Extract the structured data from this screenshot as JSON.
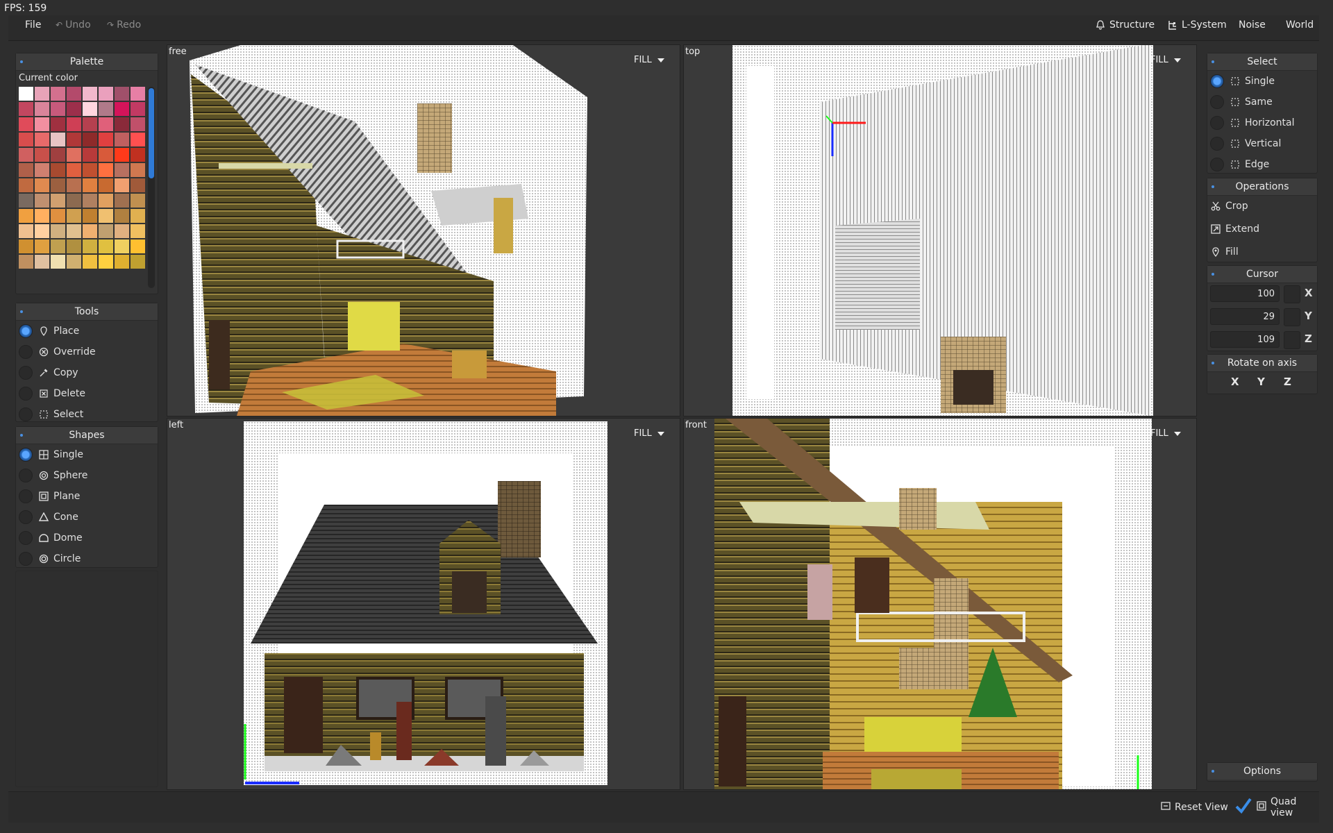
{
  "fps": "FPS: 159",
  "menu": {
    "file": "File",
    "undo": "Undo",
    "redo": "Redo"
  },
  "top_right": {
    "structure": "Structure",
    "lsystem": "L-System",
    "noise": "Noise",
    "world": "World"
  },
  "palette": {
    "title": "Palette",
    "current_color_label": "Current color",
    "colors": [
      "#ffffff",
      "#e8a3b8",
      "#d4708e",
      "#b34a6b",
      "#f2b8cc",
      "#eaa0bd",
      "#a0506a",
      "#e77fa5",
      "#c24760",
      "#d9849a",
      "#c85a7c",
      "#9c2f4b",
      "#ffd6df",
      "#b07a8a",
      "#d4145a",
      "#c23a63",
      "#e04b5a",
      "#f28fa0",
      "#a03040",
      "#cf3f55",
      "#b5404f",
      "#e0607a",
      "#8a2a3a",
      "#c0506a",
      "#d84d4d",
      "#e86a6a",
      "#e8c4c4",
      "#b03838",
      "#8e2a2a",
      "#e04040",
      "#c06060",
      "#ff5050",
      "#d06060",
      "#c8504a",
      "#a04040",
      "#e07060",
      "#b83a3a",
      "#d85a3a",
      "#ff3a1a",
      "#c03020",
      "#b0604a",
      "#d08070",
      "#a84a30",
      "#e06040",
      "#c05030",
      "#ff7040",
      "#b87060",
      "#d07850",
      "#c06a40",
      "#e08a50",
      "#9c6040",
      "#b87050",
      "#e08040",
      "#c86a30",
      "#f0a070",
      "#a05a3a",
      "#7a6a60",
      "#c09070",
      "#d0a070",
      "#8c6a50",
      "#b08060",
      "#e0a060",
      "#a07050",
      "#c09050",
      "#f0a040",
      "#ffb060",
      "#e09040",
      "#d0a050",
      "#c08030",
      "#f0c070",
      "#b08040",
      "#e0b050",
      "#f0c090",
      "#ffd0a0",
      "#d0b080",
      "#e0c090",
      "#f0b070",
      "#c0a070",
      "#e0b080",
      "#f0c060",
      "#d09030",
      "#e0a040",
      "#c0a050",
      "#b09040",
      "#d0b040",
      "#e0c040",
      "#f0d060",
      "#ffc030",
      "#c09060",
      "#e0c0a0",
      "#f0e0b0",
      "#d0b070",
      "#f0c040",
      "#ffd040",
      "#e0b030",
      "#c0a030"
    ]
  },
  "tools": {
    "title": "Tools",
    "items": [
      {
        "label": "Place",
        "icon": "stamp-icon",
        "selected": true
      },
      {
        "label": "Override",
        "icon": "override-icon",
        "selected": false
      },
      {
        "label": "Copy",
        "icon": "dropper-icon",
        "selected": false
      },
      {
        "label": "Delete",
        "icon": "delete-icon",
        "selected": false
      },
      {
        "label": "Select",
        "icon": "select-icon",
        "selected": false
      }
    ]
  },
  "shapes": {
    "title": "Shapes",
    "items": [
      {
        "label": "Single",
        "icon": "single-icon",
        "selected": true
      },
      {
        "label": "Sphere",
        "icon": "sphere-icon",
        "selected": false
      },
      {
        "label": "Plane",
        "icon": "plane-icon",
        "selected": false
      },
      {
        "label": "Cone",
        "icon": "cone-icon",
        "selected": false
      },
      {
        "label": "Dome",
        "icon": "dome-icon",
        "selected": false
      },
      {
        "label": "Circle",
        "icon": "circle-icon",
        "selected": false
      }
    ]
  },
  "viewports": {
    "free": {
      "label": "free",
      "mode": "FILL"
    },
    "top": {
      "label": "top",
      "mode": "FILL"
    },
    "left": {
      "label": "left",
      "mode": "FILL"
    },
    "front": {
      "label": "front",
      "mode": "FILL"
    }
  },
  "select": {
    "title": "Select",
    "items": [
      {
        "label": "Single",
        "selected": true
      },
      {
        "label": "Same",
        "selected": false
      },
      {
        "label": "Horizontal",
        "selected": false
      },
      {
        "label": "Vertical",
        "selected": false
      },
      {
        "label": "Edge",
        "selected": false
      }
    ]
  },
  "operations": {
    "title": "Operations",
    "items": [
      {
        "label": "Crop",
        "icon": "crop-icon"
      },
      {
        "label": "Extend",
        "icon": "extend-icon"
      },
      {
        "label": "Fill",
        "icon": "fill-icon"
      }
    ]
  },
  "cursor": {
    "title": "Cursor",
    "x": "100",
    "y": "29",
    "z": "109",
    "x_label": "X",
    "y_label": "Y",
    "z_label": "Z"
  },
  "rotate": {
    "title": "Rotate on axis",
    "x": "X",
    "y": "Y",
    "z": "Z"
  },
  "options": {
    "title": "Options"
  },
  "bottom": {
    "reset_view": "Reset View",
    "quad_view": "Quad view",
    "quad_view_checked": true
  },
  "colors": {
    "accent": "#2f7ad6",
    "panel": "#333333",
    "background": "#2e2e2e"
  }
}
